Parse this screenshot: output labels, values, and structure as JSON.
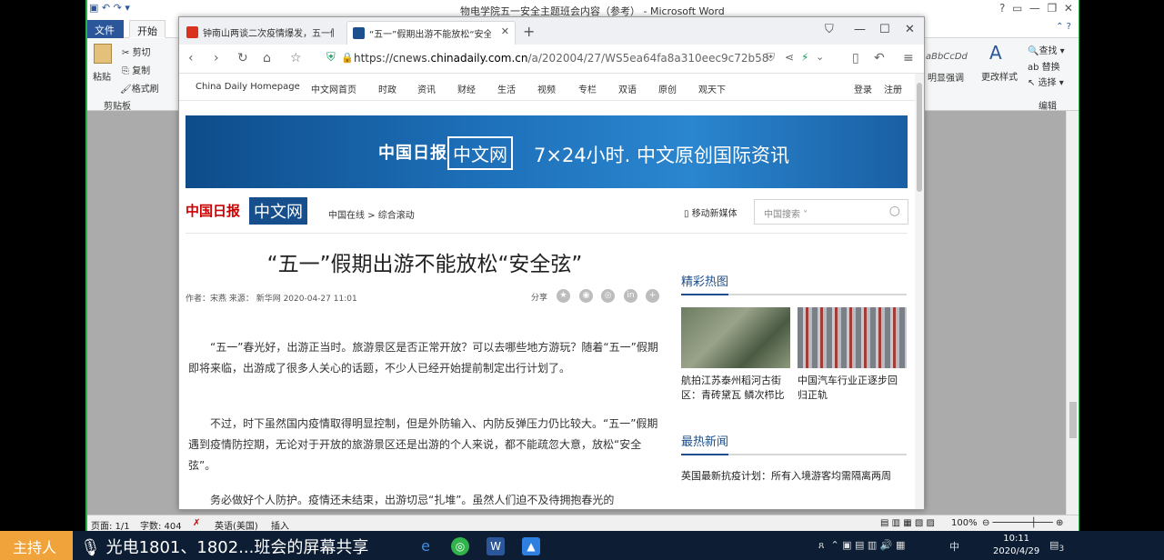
{
  "word": {
    "title": "物电学院五一安全主题班会内容（参考） - Microsoft Word",
    "tabs": [
      "文件",
      "开始"
    ],
    "ribbon": {
      "paste": "粘贴",
      "cut": "剪切",
      "copy": "复制",
      "format_painter": "格式刷",
      "clipboard_group": "剪贴板",
      "style_preview": "aBbCcDd",
      "style_name": "明显强调",
      "change_styles": "更改样式",
      "find": "查找",
      "replace": "替换",
      "select": "选择",
      "edit_group": "编辑"
    },
    "status": {
      "page": "页面: 1/1",
      "words": "字数: 404",
      "lang": "英语(美国)",
      "insert": "插入",
      "zoom": "100%"
    }
  },
  "browser": {
    "tabs": [
      {
        "title": "钟南山两谈二次疫情爆发，五一假",
        "active": false
      },
      {
        "title": "“五一”假期出游不能放松“安全弦”",
        "active": true
      }
    ],
    "url": {
      "scheme": "https://cnews.",
      "domain": "chinadaily.com.cn",
      "path": "/a/202004/27/WS5ea64fa8a310eec9c72b58"
    },
    "nav": [
      "China Daily Homepage",
      "中文网首页",
      "时政",
      "资讯",
      "财经",
      "生活",
      "视频",
      "专栏",
      "双语",
      "原创",
      "观天下"
    ],
    "login": "登录",
    "register": "注册"
  },
  "site": {
    "banner_logo_cn": "中国日报",
    "banner_logo_box": "中文网",
    "banner_slogan": "7×24小时. 中文原创国际资讯",
    "header_logo1": "中国日报",
    "header_logo2": "中文网",
    "breadcrumb": "中国在线 > 综合滚动",
    "mobile": "移动新媒体",
    "search_placeholder": "中国搜索 ˅"
  },
  "article": {
    "title": "“五一”假期出游不能放松“安全弦”",
    "meta": "作者：宋燕 来源：  新华网  2020-04-27 11:01",
    "share_label": "分享",
    "paragraphs": [
      "“五一”春光好，出游正当时。旅游景区是否正常开放？可以去哪些地方游玩？随着“五一”假期即将来临，出游成了很多人关心的话题，不少人已经开始提前制定出行计划了。",
      "不过，时下虽然国内疫情取得明显控制，但是外防输入、内防反弹压力仍比较大。“五一”假期遇到疫情防控期，无论对于开放的旅游景区还是出游的个人来说，都不能疏忽大意，放松“安全弦”。",
      "务必做好个人防护。疫情还未结束，出游切忌“扎堆”。虽然人们迫不及待拥抱春光的"
    ]
  },
  "sidebar": {
    "hot_pics_title": "精彩热图",
    "pics": [
      {
        "caption": "航拍江苏泰州稻河古街区：青砖黛瓦 鳞次栉比"
      },
      {
        "caption": "中国汽车行业正逐步回归正轨"
      }
    ],
    "hot_news_title": "最热新闻",
    "hot_news": [
      "英国最新抗疫计划：所有入境游客均需隔离两周"
    ]
  },
  "meeting": {
    "host": "主持人",
    "share_label": "光电1801、1802...班会的屏幕共享"
  },
  "taskbar": {
    "time": "10:11",
    "date": "2020/4/29",
    "ime": "中",
    "notifications": "3"
  },
  "colors": {
    "accent_blue": "#1d4f8c",
    "meeting_green": "#27b24a",
    "host_orange": "#f0a33a"
  }
}
